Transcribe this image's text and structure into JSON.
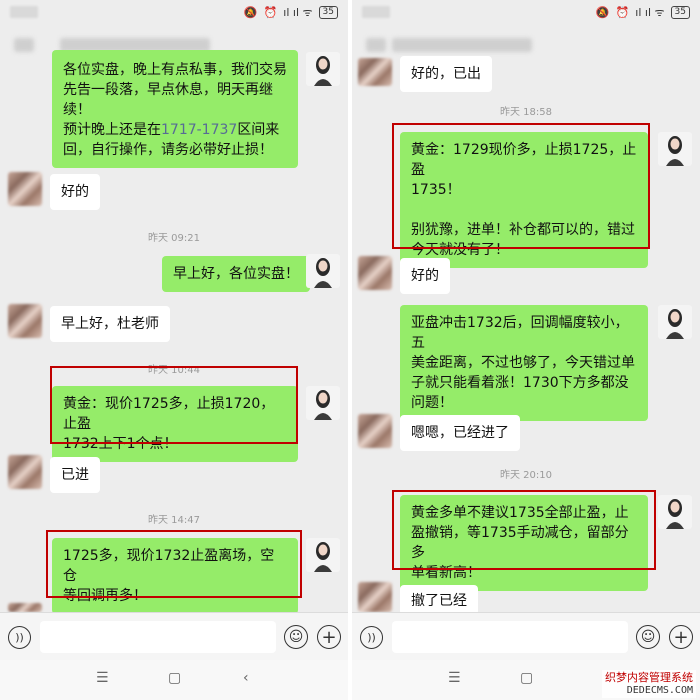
{
  "left": {
    "timestamps": [
      "昨天 09:21",
      "昨天 10:44",
      "昨天 14:47"
    ],
    "messages": {
      "m1_line1": "各位实盘，晚上有点私事，我们交易",
      "m1_line2": "先告一段落，早点休息，明天再继",
      "m1_line3": "续！",
      "m1_line4a": "预计晚上还是在",
      "m1_range": "1717-1737",
      "m1_line4b": "区间来",
      "m1_line5": "回，自行操作，请务必带好止损！",
      "m2": "好的",
      "m3": "早上好，各位实盘！",
      "m4": "早上好，杜老师",
      "m5": "黄金：现价1725多，止损1720，止盈\n1732上下1个点！",
      "m6": "已进",
      "m7": "1725多，现价1732止盈离场，空仓\n等回调再多！"
    }
  },
  "right": {
    "timestamps": [
      "昨天 18:58",
      "昨天 20:10"
    ],
    "messages": {
      "m1": "好的，已出",
      "m2": "黄金：1729现价多，止损1725，止盈\n1735！\n\n别犹豫，进单！补仓都可以的，错过\n今天就没有了！",
      "m3": "好的",
      "m4": "亚盘冲击1732后，回调幅度较小，五\n美金距离，不过也够了，今天错过单\n子就只能看着涨！1730下方多都没\n问题！",
      "m5": "嗯嗯，已经进了",
      "m6": "黄金多单不建议1735全部止盈，止\n盈撤销，等1735手动减仓，留部分多\n单看新高！",
      "m7": "撤了已经"
    }
  },
  "status": {
    "battery": "35",
    "signal": "ıl ıl ᯤ"
  },
  "watermark": {
    "line1": "织梦内容管理系统",
    "line2": "DEDECMS.COM"
  },
  "colors": {
    "outgoing_bubble": "#95ec69",
    "incoming_bubble": "#ffffff",
    "chat_bg": "#ededed",
    "highlight_box": "#c00000",
    "link_text": "#576b95"
  },
  "icons": {
    "voice": "voice-icon",
    "emoji": "emoji-icon",
    "plus": "plus-icon",
    "nav_menu": "menu-icon",
    "nav_home": "home-icon",
    "nav_back": "back-icon"
  }
}
